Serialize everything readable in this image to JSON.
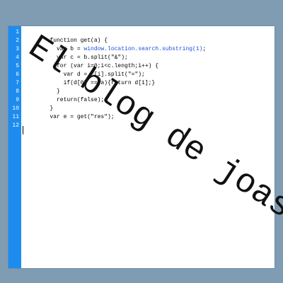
{
  "editor": {
    "line_numbers": [
      "1",
      "2",
      "3",
      "4",
      "5",
      "6",
      "7",
      "8",
      "9",
      "10",
      "11",
      "12"
    ],
    "lines": [
      {
        "before": "function get(a) {",
        "highlight": "",
        "after": ""
      },
      {
        "before": "  var b = ",
        "highlight": "window.location.search.substring(1)",
        "after": ";"
      },
      {
        "before": "  var c = b.split(\"&\");",
        "highlight": "",
        "after": ""
      },
      {
        "before": "  for (var i=0;i<c.length;i++) {",
        "highlight": "",
        "after": ""
      },
      {
        "before": "    var d = c[i].split(\"=\");",
        "highlight": "",
        "after": ""
      },
      {
        "before": "    if(d[0] == a){return d[1];}",
        "highlight": "",
        "after": ""
      },
      {
        "before": "  }",
        "highlight": "",
        "after": ""
      },
      {
        "before": "  return(false);",
        "highlight": "",
        "after": ""
      },
      {
        "before": "}",
        "highlight": "",
        "after": ""
      },
      {
        "before": "var e = get(\"res\");",
        "highlight": "",
        "after": ""
      },
      {
        "before": "",
        "highlight": "",
        "after": ""
      },
      {
        "before": "",
        "highlight": "",
        "after": ""
      }
    ]
  },
  "watermark": {
    "text": "El blog de joason"
  },
  "colors": {
    "frame": "#7f9cb2",
    "gutter": "#1d8cf0",
    "highlight": "#1a4fd8",
    "text": "#000000"
  }
}
